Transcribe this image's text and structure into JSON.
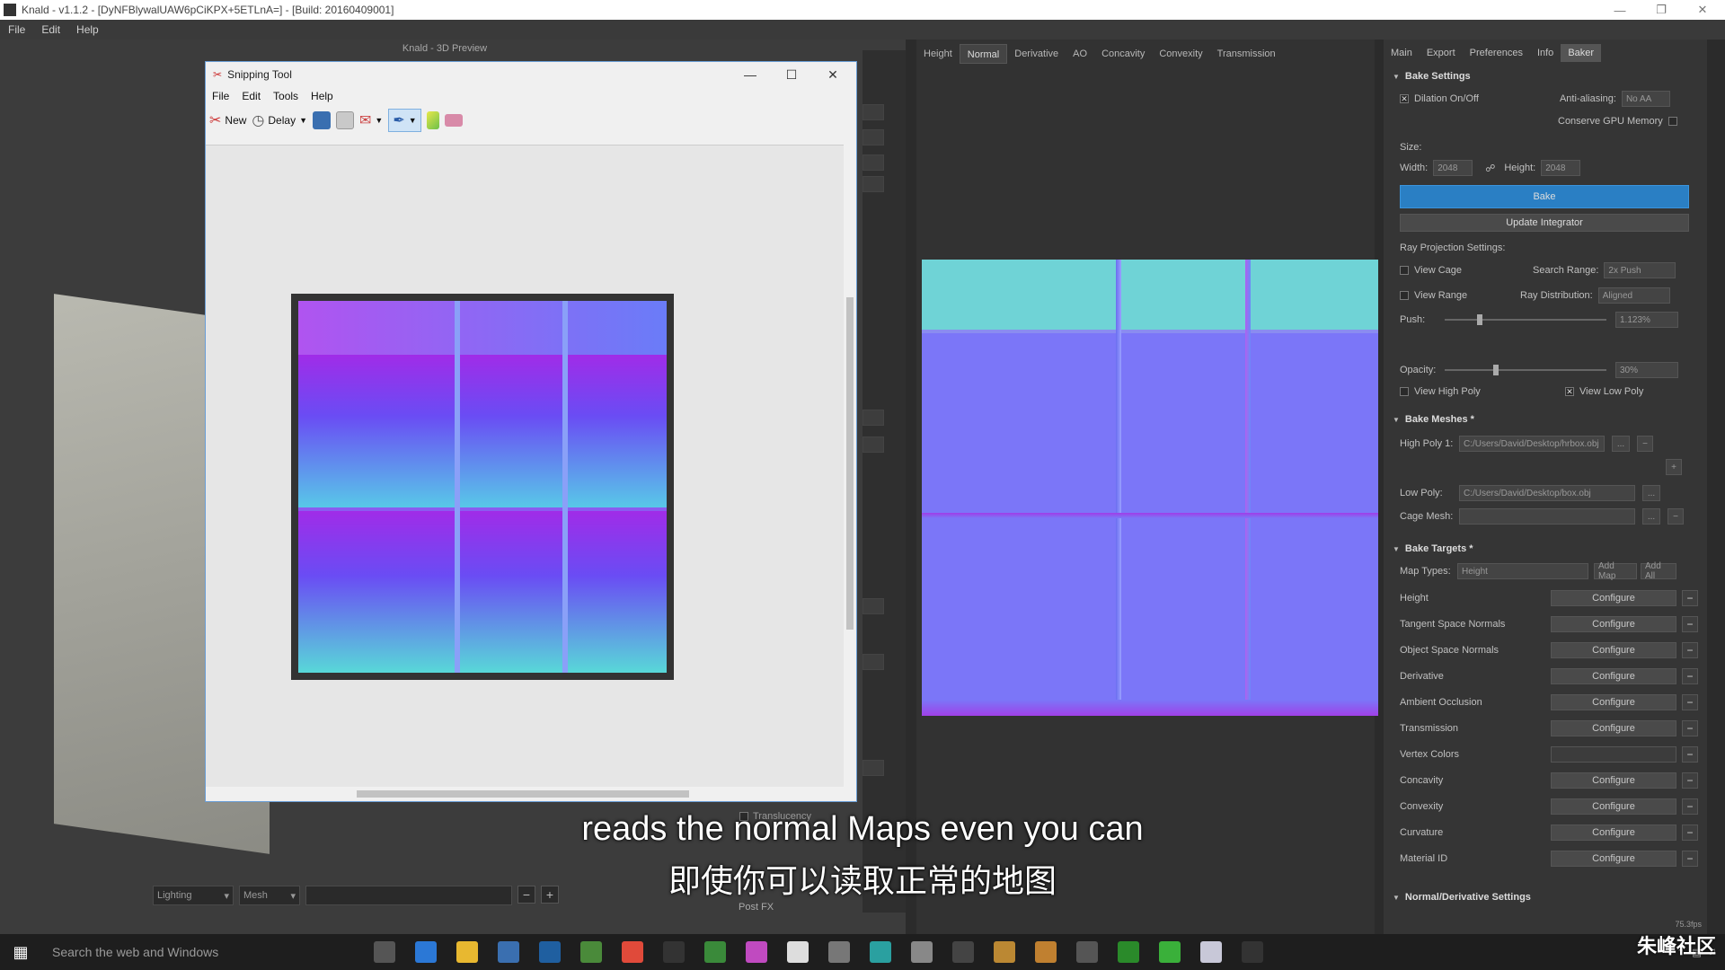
{
  "window": {
    "title": "Knald - v1.1.2 - [DyNFBlywalUAW6pCiKPX+5ETLnA=] - [Build: 20160409001]",
    "menu": [
      "File",
      "Edit",
      "Help"
    ]
  },
  "viewport": {
    "title": "Knald - 3D Preview",
    "bottom_controls": {
      "lighting": "Lighting",
      "mesh": "Mesh"
    },
    "translucency_label": "Translucency",
    "postfx_label": "Post FX"
  },
  "center": {
    "tabs": [
      "Height",
      "Normal",
      "Derivative",
      "AO",
      "Concavity",
      "Convexity",
      "Transmission"
    ],
    "active_tab": "Normal"
  },
  "right": {
    "tabs": [
      "Main",
      "Export",
      "Preferences",
      "Info",
      "Baker"
    ],
    "active_tab": "Baker",
    "bake_settings": {
      "header": "Bake Settings",
      "dilation": "Dilation On/Off",
      "anti_aliasing_label": "Anti-aliasing:",
      "anti_aliasing_value": "No AA",
      "conserve_gpu": "Conserve GPU Memory",
      "size_label": "Size:",
      "width_label": "Width:",
      "width_value": "2048",
      "height_label": "Height:",
      "height_value": "2048",
      "bake_button": "Bake",
      "update_integrator": "Update Integrator",
      "ray_projection": "Ray Projection Settings:",
      "view_cage": "View Cage",
      "search_range_label": "Search Range:",
      "search_range_value": "2x Push",
      "view_range": "View Range",
      "ray_distribution_label": "Ray Distribution:",
      "ray_distribution_value": "Aligned",
      "push_label": "Push:",
      "push_value": "1.123%",
      "opacity_label": "Opacity:",
      "opacity_value": "30%",
      "view_high_poly": "View High Poly",
      "view_low_poly": "View Low Poly"
    },
    "bake_meshes": {
      "header": "Bake Meshes *",
      "high_poly_label": "High Poly 1:",
      "high_poly_value": "C:/Users/David/Desktop/hrbox.obj",
      "low_poly_label": "Low Poly:",
      "low_poly_value": "C:/Users/David/Desktop/box.obj",
      "cage_mesh_label": "Cage Mesh:",
      "browse": "..."
    },
    "bake_targets": {
      "header": "Bake Targets *",
      "map_types_label": "Map Types:",
      "map_types_value": "Height",
      "add_map": "Add Map",
      "add_all": "Add All",
      "configure": "Configure",
      "items": [
        "Height",
        "Tangent Space Normals",
        "Object Space Normals",
        "Derivative",
        "Ambient Occlusion",
        "Transmission",
        "Vertex Colors",
        "Concavity",
        "Convexity",
        "Curvature",
        "Material ID"
      ]
    },
    "normal_derivative_header": "Normal/Derivative Settings",
    "corner_readout": "75.3fps"
  },
  "snipping_tool": {
    "title": "Snipping Tool",
    "menu": [
      "File",
      "Edit",
      "Tools",
      "Help"
    ],
    "new_label": "New",
    "delay_label": "Delay"
  },
  "caption": {
    "english": "reads the normal Maps even you can",
    "chinese": "即使你可以读取正常的地图"
  },
  "taskbar": {
    "search_placeholder": "Search the web and Windows",
    "apps": [
      "task-view",
      "edge",
      "explorer",
      "store",
      "photoshop",
      "app-green",
      "chrome",
      "epic",
      "app-2",
      "itunes",
      "photos",
      "app-3",
      "app-4",
      "app-5",
      "unreal",
      "zbrush",
      "app-6",
      "calculator",
      "app-7",
      "app-8",
      "knald",
      "app-9"
    ]
  },
  "watermark": "朱峰社区"
}
